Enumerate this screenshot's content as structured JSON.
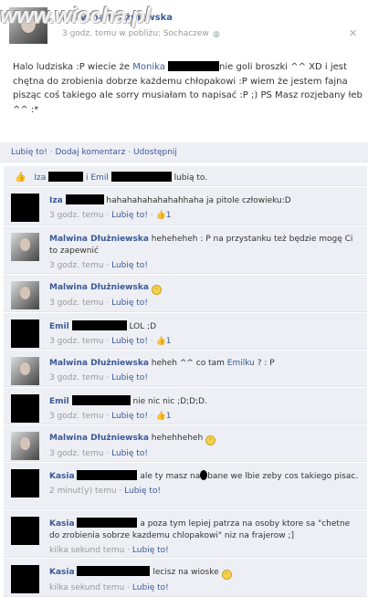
{
  "watermark": "www.wiocha.pl",
  "post": {
    "author": "Malwina Dłużniewska",
    "meta": "3 godz. temu w pobliżu: Sochaczew",
    "text_1": "Halo ludziska :P wiecie że ",
    "mention": "Monika",
    "text_2": "nie goli broszki ^^ XD i jest chętna do zrobienia dobrze każdemu chłopakowi :P wiem że jestem fajna pisząc coś takiego ale sorry musiałam to napisać :P ;) PS Masz rozjebany łeb ^^ :*"
  },
  "actions": {
    "like": "Lubię to!",
    "comment": "Dodaj komentarz",
    "share": "Udostępnij"
  },
  "likes": {
    "name1": "Iza",
    "and": "i",
    "name2": "Emil",
    "suffix": "lubią to."
  },
  "comments": [
    {
      "name": "Iza",
      "text": "hahahahahahahahhaha ja pitole człowieku:D",
      "meta_time": "3 godz. temu",
      "like": "Lubię to!",
      "likes_count": "1"
    },
    {
      "name": "Malwina Dłużniewska",
      "text": "heheheheh : P na przystanku też będzie mogę Ci to zapewnić",
      "meta_time": "3 godz. temu",
      "like": "Lubię to!"
    },
    {
      "name": "Malwina Dłużniewska",
      "text": "",
      "meta_time": "3 godz. temu",
      "like": "Lubię to!"
    },
    {
      "name": "Emil",
      "text": "LOL ;D",
      "meta_time": "3 godz. temu",
      "like": "Lubię to!",
      "likes_count": "1"
    },
    {
      "name": "Malwina Dłużniewska",
      "text": "heheh ^^ co tam ",
      "mention": "Emilku",
      "text_after": " ? : P",
      "meta_time": "3 godz. temu",
      "like": "Lubię to!"
    },
    {
      "name": "Emil",
      "text": "nie nic nic ;D;D;D.",
      "meta_time": "3 godz. temu",
      "like": "Lubię to!",
      "likes_count": "1"
    },
    {
      "name": "Malwina Dłużniewska",
      "text": "hehehheheh",
      "meta_time": "3 godz. temu",
      "like": "Lubię to!"
    },
    {
      "name": "Kasia",
      "text_a": "ale ty masz na",
      "text_b": "bane we lbie zeby cos takiego pisac.",
      "meta_time": "2 minut(y) temu",
      "like": "Lubię to!"
    },
    {
      "name": "Kasia",
      "text": "a poza tym lepiej patrza na osoby ktore sa \"chetne do zrobienia sobrze kazdemu chlopakowi\" niz na frajerow ;]",
      "meta_time": "kilka sekund temu",
      "like": "Lubię to!"
    },
    {
      "name": "Kasia",
      "text": "lecisz na wioske",
      "meta_time": "kilka sekund temu",
      "like": "Lubię to!"
    }
  ],
  "colors": {
    "link": "#3b5998",
    "comment_bg": "#edeff4"
  }
}
